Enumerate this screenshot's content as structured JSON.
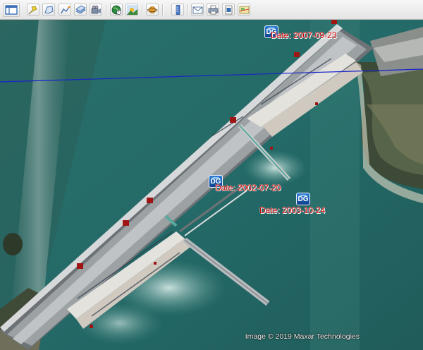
{
  "toolbar": {
    "buttons": [
      {
        "name": "sidebar-toggle-button",
        "icon": "panel-icon"
      },
      {
        "name": "add-placemark-button",
        "icon": "pushpin-icon"
      },
      {
        "name": "add-polygon-button",
        "icon": "polygon-icon"
      },
      {
        "name": "add-path-button",
        "icon": "path-icon"
      },
      {
        "name": "add-image-overlay-button",
        "icon": "overlay-icon"
      },
      {
        "name": "record-tour-button",
        "icon": "tour-icon"
      },
      {
        "name": "historical-imagery-button",
        "icon": "clock-globe-icon"
      },
      {
        "name": "sunlight-button",
        "icon": "sun-landscape-icon"
      },
      {
        "name": "switch-planet-button",
        "icon": "planet-icon"
      },
      {
        "name": "ruler-button",
        "icon": "ruler-icon"
      },
      {
        "name": "email-button",
        "icon": "envelope-icon"
      },
      {
        "name": "print-button",
        "icon": "printer-icon"
      },
      {
        "name": "save-image-button",
        "icon": "save-image-icon"
      },
      {
        "name": "view-in-maps-button",
        "icon": "map-view-icon"
      }
    ]
  },
  "map": {
    "imagery_markers": [
      {
        "icon_text": "DG",
        "date_label": "Date: 2007-09-23"
      },
      {
        "icon_text": "DG",
        "date_label": "Date: 2002-07-20"
      },
      {
        "icon_text": "DG",
        "date_label": "Date: 2003-10-24"
      }
    ],
    "attribution": "Image © 2019 Maxar Technologies",
    "colors": {
      "label": "#d10000",
      "water": "#256b68",
      "dam": "#9aa0a4",
      "path_line": "#1a24c8"
    }
  }
}
